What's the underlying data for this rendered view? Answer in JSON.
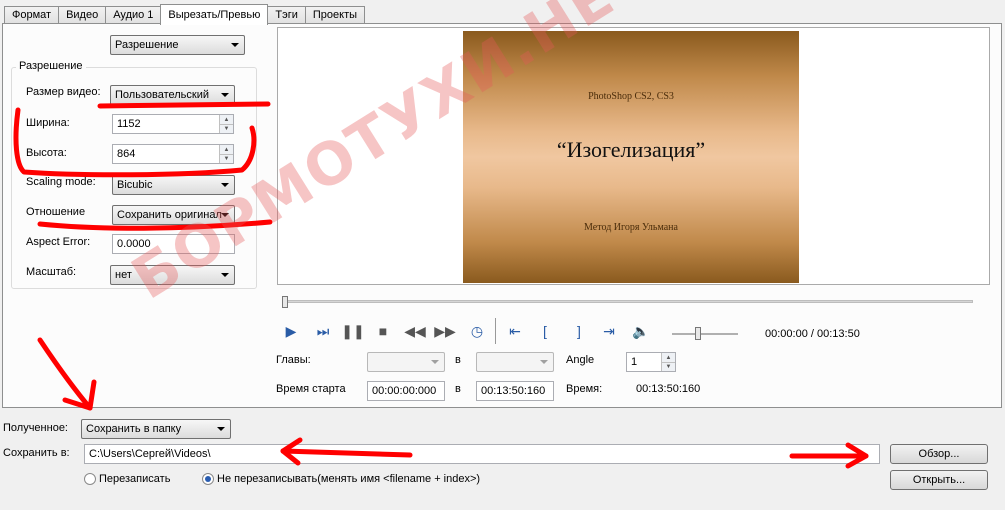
{
  "tabs": [
    "Формат",
    "Видео",
    "Аудио 1",
    "Вырезать/Превью",
    "Тэги",
    "Проекты"
  ],
  "active_tab": 3,
  "left": {
    "top_combo": "Разрешение",
    "group_title": "Разрешение",
    "video_size_label": "Размер видео:",
    "video_size_value": "Пользовательский",
    "width_label": "Ширина:",
    "width_value": "1152",
    "height_label": "Высота:",
    "height_value": "864",
    "scaling_label": "Scaling mode:",
    "scaling_value": "Bicubic",
    "ratio_label": "Отношение",
    "ratio_value": "Сохранить оригинал",
    "aspect_error_label": "Aspect Error:",
    "aspect_error_value": "0.0000",
    "scale_label": "Масштаб:",
    "scale_value": "нет"
  },
  "preview": {
    "line1": "PhotoShop CS2, CS3",
    "line2": "“Изогелизация”",
    "line3": "Метод Игоря Ульмана"
  },
  "player": {
    "time": "00:00:00 / 00:13:50",
    "chapters_label": "Главы:",
    "in_label_1": "в",
    "angle_label": "Angle",
    "angle_value": "1",
    "start_label": "Время старта",
    "start_value": "00:00:00:000",
    "in_label_2": "в",
    "end_value": "00:13:50:160",
    "duration_label": "Время:",
    "duration_value": "00:13:50:160"
  },
  "bottom": {
    "output_label": "Полученное:",
    "output_value": "Сохранить в папку",
    "save_label": "Сохранить в:",
    "save_path": "C:\\Users\\Сергей\\Videos\\",
    "browse_label": "Обзор...",
    "open_label": "Открыть...",
    "overwrite_label": "Перезаписать",
    "no_overwrite_label": "Не перезаписывать(менять имя <filename + index>)"
  },
  "watermark": "БОРМОТУХИ.НЕТ",
  "colors": {
    "annotation_red": "#ff0000",
    "accent_blue": "#2a5ca6"
  }
}
